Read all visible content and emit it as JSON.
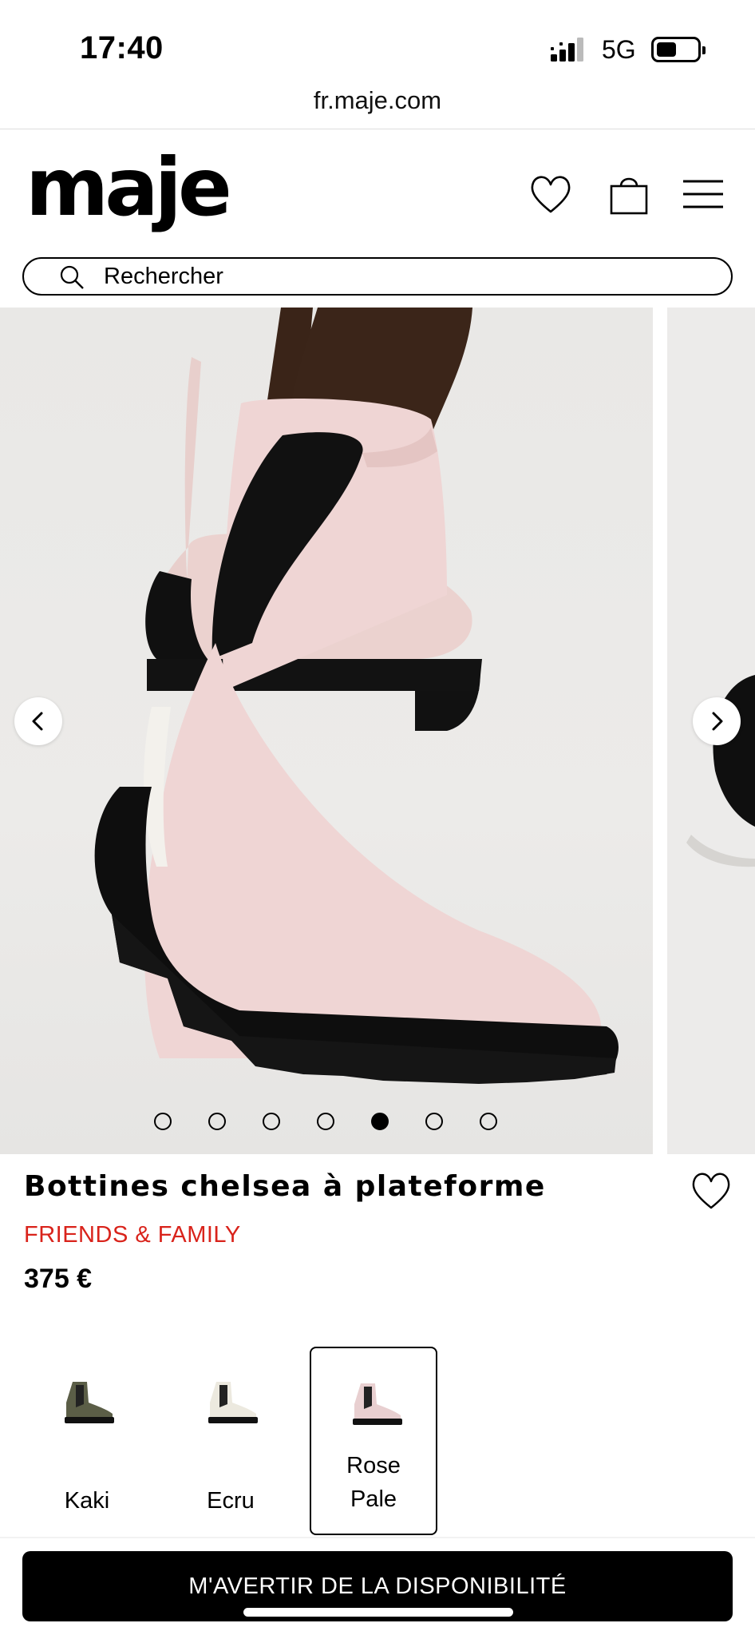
{
  "status_bar": {
    "time": "17:40",
    "network": "5G",
    "icons": [
      "signal-icon",
      "battery-icon"
    ]
  },
  "browser": {
    "url": "fr.maje.com"
  },
  "header": {
    "logo": "maje",
    "icons": [
      "heart-icon",
      "bag-icon",
      "menu-icon"
    ]
  },
  "search": {
    "placeholder": "Rechercher"
  },
  "gallery": {
    "slide_count": 7,
    "active_slide_index": 4,
    "icons": [
      "chevron-left-icon",
      "chevron-right-icon"
    ]
  },
  "product": {
    "title": "Bottines chelsea à plateforme",
    "promo": "FRIENDS & FAMILY",
    "price": "375 €"
  },
  "colors": {
    "options": [
      {
        "label": "Kaki",
        "selected": false,
        "swatch_color": "#5b5e47"
      },
      {
        "label": "Ecru",
        "selected": false,
        "swatch_color": "#ece9df"
      },
      {
        "label": "Rose",
        "label_line2": "Pale",
        "selected": true,
        "swatch_color": "#e8cfd0"
      }
    ]
  },
  "cta": {
    "label": "M'AVERTIR DE LA DISPONIBILITÉ"
  },
  "theme": {
    "accent": "#000000",
    "promo_color": "#d9231b",
    "boot_color": "#efd5d4"
  }
}
